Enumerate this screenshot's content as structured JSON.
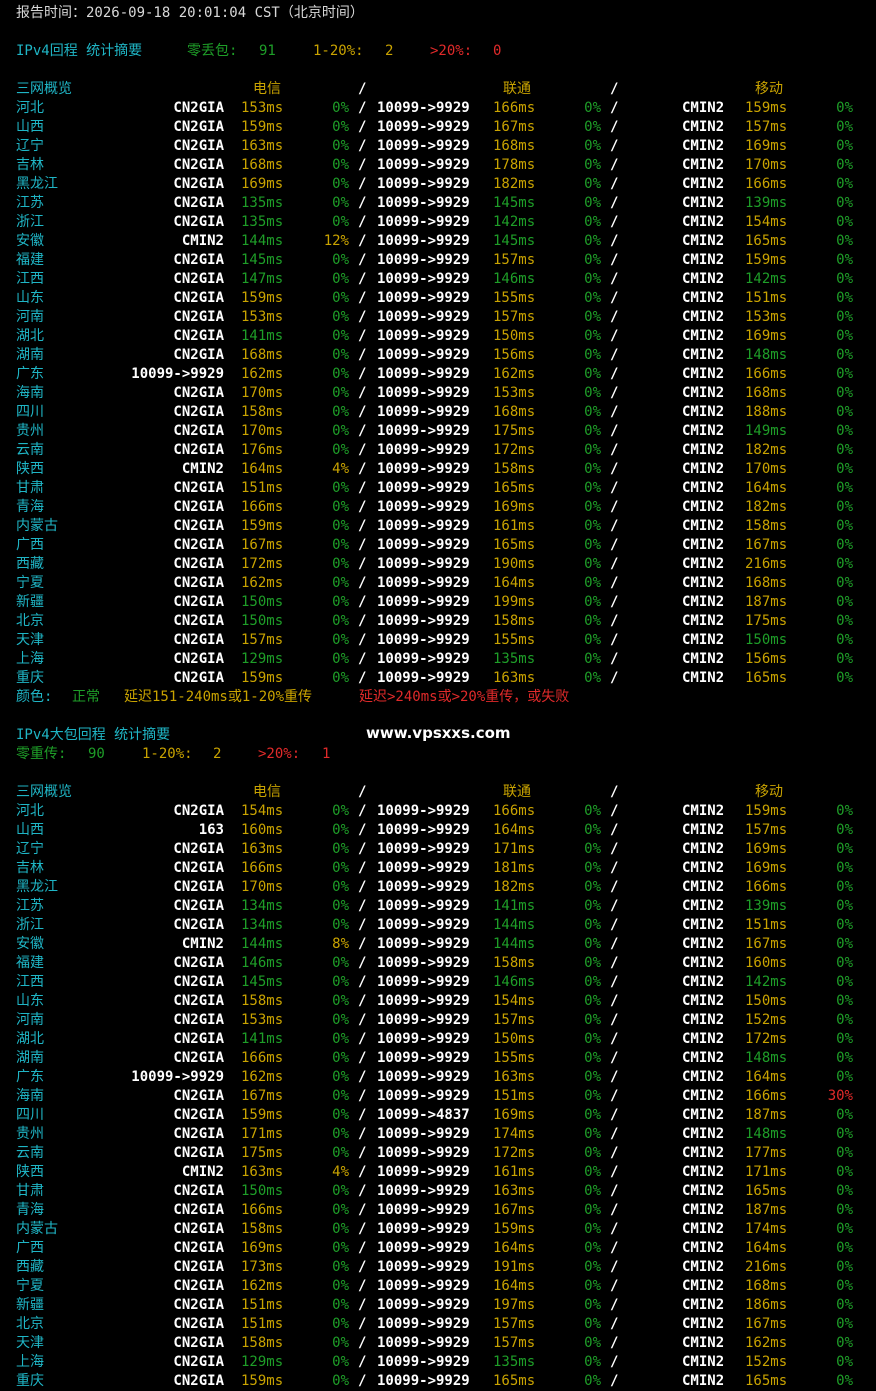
{
  "report_time": "报告时间：2026-09-18 20:01:04 CST（北京时间）",
  "colors": {
    "background": "#000000",
    "normal": "#1e9e28",
    "warn": "#c9a300",
    "bad": "#e02a2a",
    "label": "#1fb5c5",
    "route": "#ffffff"
  },
  "watermark": "www.vpsxxs.com",
  "legend": {
    "label": "颜色:",
    "normal": "正常",
    "warn": "延迟151-240ms或1-20%重传",
    "bad": "延迟>240ms或>20%重传，或失败"
  },
  "header": {
    "region": "三网概览",
    "telecom": "电信",
    "sep": "/",
    "unicom": "联通",
    "mobile": "移动"
  },
  "sections": [
    {
      "title": "IPv4回程 统计摘要",
      "summary": [
        {
          "label": "零丢包:",
          "value": "91",
          "level": "g"
        },
        {
          "label": "1-20%:",
          "value": "2",
          "level": "y"
        },
        {
          "label": ">20%:",
          "value": "0",
          "level": "r"
        }
      ],
      "rows": [
        [
          "河北",
          "CN2GIA",
          "153ms",
          "y",
          "0%",
          "g",
          "10099->9929",
          "166ms",
          "y",
          "0%",
          "g",
          "CMIN2",
          "159ms",
          "y",
          "0%",
          "g"
        ],
        [
          "山西",
          "CN2GIA",
          "159ms",
          "y",
          "0%",
          "g",
          "10099->9929",
          "167ms",
          "y",
          "0%",
          "g",
          "CMIN2",
          "157ms",
          "y",
          "0%",
          "g"
        ],
        [
          "辽宁",
          "CN2GIA",
          "163ms",
          "y",
          "0%",
          "g",
          "10099->9929",
          "168ms",
          "y",
          "0%",
          "g",
          "CMIN2",
          "169ms",
          "y",
          "0%",
          "g"
        ],
        [
          "吉林",
          "CN2GIA",
          "168ms",
          "y",
          "0%",
          "g",
          "10099->9929",
          "178ms",
          "y",
          "0%",
          "g",
          "CMIN2",
          "170ms",
          "y",
          "0%",
          "g"
        ],
        [
          "黑龙江",
          "CN2GIA",
          "169ms",
          "y",
          "0%",
          "g",
          "10099->9929",
          "182ms",
          "y",
          "0%",
          "g",
          "CMIN2",
          "166ms",
          "y",
          "0%",
          "g"
        ],
        [
          "江苏",
          "CN2GIA",
          "135ms",
          "g",
          "0%",
          "g",
          "10099->9929",
          "145ms",
          "g",
          "0%",
          "g",
          "CMIN2",
          "139ms",
          "g",
          "0%",
          "g"
        ],
        [
          "浙江",
          "CN2GIA",
          "135ms",
          "g",
          "0%",
          "g",
          "10099->9929",
          "142ms",
          "g",
          "0%",
          "g",
          "CMIN2",
          "154ms",
          "y",
          "0%",
          "g"
        ],
        [
          "安徽",
          "CMIN2",
          "144ms",
          "g",
          "12%",
          "y",
          "10099->9929",
          "145ms",
          "g",
          "0%",
          "g",
          "CMIN2",
          "165ms",
          "y",
          "0%",
          "g"
        ],
        [
          "福建",
          "CN2GIA",
          "145ms",
          "g",
          "0%",
          "g",
          "10099->9929",
          "157ms",
          "y",
          "0%",
          "g",
          "CMIN2",
          "159ms",
          "y",
          "0%",
          "g"
        ],
        [
          "江西",
          "CN2GIA",
          "147ms",
          "g",
          "0%",
          "g",
          "10099->9929",
          "146ms",
          "g",
          "0%",
          "g",
          "CMIN2",
          "142ms",
          "g",
          "0%",
          "g"
        ],
        [
          "山东",
          "CN2GIA",
          "159ms",
          "y",
          "0%",
          "g",
          "10099->9929",
          "155ms",
          "y",
          "0%",
          "g",
          "CMIN2",
          "151ms",
          "y",
          "0%",
          "g"
        ],
        [
          "河南",
          "CN2GIA",
          "153ms",
          "y",
          "0%",
          "g",
          "10099->9929",
          "157ms",
          "y",
          "0%",
          "g",
          "CMIN2",
          "153ms",
          "y",
          "0%",
          "g"
        ],
        [
          "湖北",
          "CN2GIA",
          "141ms",
          "g",
          "0%",
          "g",
          "10099->9929",
          "150ms",
          "y",
          "0%",
          "g",
          "CMIN2",
          "169ms",
          "y",
          "0%",
          "g"
        ],
        [
          "湖南",
          "CN2GIA",
          "168ms",
          "y",
          "0%",
          "g",
          "10099->9929",
          "156ms",
          "y",
          "0%",
          "g",
          "CMIN2",
          "148ms",
          "g",
          "0%",
          "g"
        ],
        [
          "广东",
          "10099->9929",
          "162ms",
          "y",
          "0%",
          "g",
          "10099->9929",
          "162ms",
          "y",
          "0%",
          "g",
          "CMIN2",
          "166ms",
          "y",
          "0%",
          "g"
        ],
        [
          "海南",
          "CN2GIA",
          "170ms",
          "y",
          "0%",
          "g",
          "10099->9929",
          "153ms",
          "y",
          "0%",
          "g",
          "CMIN2",
          "168ms",
          "y",
          "0%",
          "g"
        ],
        [
          "四川",
          "CN2GIA",
          "158ms",
          "y",
          "0%",
          "g",
          "10099->9929",
          "168ms",
          "y",
          "0%",
          "g",
          "CMIN2",
          "188ms",
          "y",
          "0%",
          "g"
        ],
        [
          "贵州",
          "CN2GIA",
          "170ms",
          "y",
          "0%",
          "g",
          "10099->9929",
          "175ms",
          "y",
          "0%",
          "g",
          "CMIN2",
          "149ms",
          "g",
          "0%",
          "g"
        ],
        [
          "云南",
          "CN2GIA",
          "176ms",
          "y",
          "0%",
          "g",
          "10099->9929",
          "172ms",
          "y",
          "0%",
          "g",
          "CMIN2",
          "182ms",
          "y",
          "0%",
          "g"
        ],
        [
          "陕西",
          "CMIN2",
          "164ms",
          "y",
          "4%",
          "y",
          "10099->9929",
          "158ms",
          "y",
          "0%",
          "g",
          "CMIN2",
          "170ms",
          "y",
          "0%",
          "g"
        ],
        [
          "甘肃",
          "CN2GIA",
          "151ms",
          "y",
          "0%",
          "g",
          "10099->9929",
          "165ms",
          "y",
          "0%",
          "g",
          "CMIN2",
          "164ms",
          "y",
          "0%",
          "g"
        ],
        [
          "青海",
          "CN2GIA",
          "166ms",
          "y",
          "0%",
          "g",
          "10099->9929",
          "169ms",
          "y",
          "0%",
          "g",
          "CMIN2",
          "182ms",
          "y",
          "0%",
          "g"
        ],
        [
          "内蒙古",
          "CN2GIA",
          "159ms",
          "y",
          "0%",
          "g",
          "10099->9929",
          "161ms",
          "y",
          "0%",
          "g",
          "CMIN2",
          "158ms",
          "y",
          "0%",
          "g"
        ],
        [
          "广西",
          "CN2GIA",
          "167ms",
          "y",
          "0%",
          "g",
          "10099->9929",
          "165ms",
          "y",
          "0%",
          "g",
          "CMIN2",
          "167ms",
          "y",
          "0%",
          "g"
        ],
        [
          "西藏",
          "CN2GIA",
          "172ms",
          "y",
          "0%",
          "g",
          "10099->9929",
          "190ms",
          "y",
          "0%",
          "g",
          "CMIN2",
          "216ms",
          "y",
          "0%",
          "g"
        ],
        [
          "宁夏",
          "CN2GIA",
          "162ms",
          "y",
          "0%",
          "g",
          "10099->9929",
          "164ms",
          "y",
          "0%",
          "g",
          "CMIN2",
          "168ms",
          "y",
          "0%",
          "g"
        ],
        [
          "新疆",
          "CN2GIA",
          "150ms",
          "g",
          "0%",
          "g",
          "10099->9929",
          "199ms",
          "y",
          "0%",
          "g",
          "CMIN2",
          "187ms",
          "y",
          "0%",
          "g"
        ],
        [
          "北京",
          "CN2GIA",
          "150ms",
          "g",
          "0%",
          "g",
          "10099->9929",
          "158ms",
          "y",
          "0%",
          "g",
          "CMIN2",
          "175ms",
          "y",
          "0%",
          "g"
        ],
        [
          "天津",
          "CN2GIA",
          "157ms",
          "y",
          "0%",
          "g",
          "10099->9929",
          "155ms",
          "y",
          "0%",
          "g",
          "CMIN2",
          "150ms",
          "g",
          "0%",
          "g"
        ],
        [
          "上海",
          "CN2GIA",
          "129ms",
          "g",
          "0%",
          "g",
          "10099->9929",
          "135ms",
          "g",
          "0%",
          "g",
          "CMIN2",
          "156ms",
          "y",
          "0%",
          "g"
        ],
        [
          "重庆",
          "CN2GIA",
          "159ms",
          "y",
          "0%",
          "g",
          "10099->9929",
          "163ms",
          "y",
          "0%",
          "g",
          "CMIN2",
          "165ms",
          "y",
          "0%",
          "g"
        ]
      ]
    },
    {
      "title": "IPv4大包回程 统计摘要",
      "summary": [
        {
          "label": "零重传:",
          "value": "90",
          "level": "g"
        },
        {
          "label": "1-20%:",
          "value": "2",
          "level": "y"
        },
        {
          "label": ">20%:",
          "value": "1",
          "level": "r"
        }
      ],
      "rows": [
        [
          "河北",
          "CN2GIA",
          "154ms",
          "y",
          "0%",
          "g",
          "10099->9929",
          "166ms",
          "y",
          "0%",
          "g",
          "CMIN2",
          "159ms",
          "y",
          "0%",
          "g"
        ],
        [
          "山西",
          "163",
          "160ms",
          "y",
          "0%",
          "g",
          "10099->9929",
          "164ms",
          "y",
          "0%",
          "g",
          "CMIN2",
          "157ms",
          "y",
          "0%",
          "g"
        ],
        [
          "辽宁",
          "CN2GIA",
          "163ms",
          "y",
          "0%",
          "g",
          "10099->9929",
          "171ms",
          "y",
          "0%",
          "g",
          "CMIN2",
          "169ms",
          "y",
          "0%",
          "g"
        ],
        [
          "吉林",
          "CN2GIA",
          "166ms",
          "y",
          "0%",
          "g",
          "10099->9929",
          "181ms",
          "y",
          "0%",
          "g",
          "CMIN2",
          "169ms",
          "y",
          "0%",
          "g"
        ],
        [
          "黑龙江",
          "CN2GIA",
          "170ms",
          "y",
          "0%",
          "g",
          "10099->9929",
          "182ms",
          "y",
          "0%",
          "g",
          "CMIN2",
          "166ms",
          "y",
          "0%",
          "g"
        ],
        [
          "江苏",
          "CN2GIA",
          "134ms",
          "g",
          "0%",
          "g",
          "10099->9929",
          "141ms",
          "g",
          "0%",
          "g",
          "CMIN2",
          "139ms",
          "g",
          "0%",
          "g"
        ],
        [
          "浙江",
          "CN2GIA",
          "134ms",
          "g",
          "0%",
          "g",
          "10099->9929",
          "144ms",
          "g",
          "0%",
          "g",
          "CMIN2",
          "151ms",
          "y",
          "0%",
          "g"
        ],
        [
          "安徽",
          "CMIN2",
          "144ms",
          "g",
          "8%",
          "y",
          "10099->9929",
          "144ms",
          "g",
          "0%",
          "g",
          "CMIN2",
          "167ms",
          "y",
          "0%",
          "g"
        ],
        [
          "福建",
          "CN2GIA",
          "146ms",
          "g",
          "0%",
          "g",
          "10099->9929",
          "158ms",
          "y",
          "0%",
          "g",
          "CMIN2",
          "160ms",
          "y",
          "0%",
          "g"
        ],
        [
          "江西",
          "CN2GIA",
          "145ms",
          "g",
          "0%",
          "g",
          "10099->9929",
          "146ms",
          "g",
          "0%",
          "g",
          "CMIN2",
          "142ms",
          "g",
          "0%",
          "g"
        ],
        [
          "山东",
          "CN2GIA",
          "158ms",
          "y",
          "0%",
          "g",
          "10099->9929",
          "154ms",
          "y",
          "0%",
          "g",
          "CMIN2",
          "150ms",
          "y",
          "0%",
          "g"
        ],
        [
          "河南",
          "CN2GIA",
          "153ms",
          "y",
          "0%",
          "g",
          "10099->9929",
          "157ms",
          "y",
          "0%",
          "g",
          "CMIN2",
          "152ms",
          "y",
          "0%",
          "g"
        ],
        [
          "湖北",
          "CN2GIA",
          "141ms",
          "g",
          "0%",
          "g",
          "10099->9929",
          "150ms",
          "y",
          "0%",
          "g",
          "CMIN2",
          "172ms",
          "y",
          "0%",
          "g"
        ],
        [
          "湖南",
          "CN2GIA",
          "166ms",
          "y",
          "0%",
          "g",
          "10099->9929",
          "155ms",
          "y",
          "0%",
          "g",
          "CMIN2",
          "148ms",
          "g",
          "0%",
          "g"
        ],
        [
          "广东",
          "10099->9929",
          "162ms",
          "y",
          "0%",
          "g",
          "10099->9929",
          "163ms",
          "y",
          "0%",
          "g",
          "CMIN2",
          "164ms",
          "y",
          "0%",
          "g"
        ],
        [
          "海南",
          "CN2GIA",
          "167ms",
          "y",
          "0%",
          "g",
          "10099->9929",
          "151ms",
          "y",
          "0%",
          "g",
          "CMIN2",
          "166ms",
          "y",
          "30%",
          "r"
        ],
        [
          "四川",
          "CN2GIA",
          "159ms",
          "y",
          "0%",
          "g",
          "10099->4837",
          "169ms",
          "y",
          "0%",
          "g",
          "CMIN2",
          "187ms",
          "y",
          "0%",
          "g"
        ],
        [
          "贵州",
          "CN2GIA",
          "171ms",
          "y",
          "0%",
          "g",
          "10099->9929",
          "174ms",
          "y",
          "0%",
          "g",
          "CMIN2",
          "148ms",
          "g",
          "0%",
          "g"
        ],
        [
          "云南",
          "CN2GIA",
          "175ms",
          "y",
          "0%",
          "g",
          "10099->9929",
          "172ms",
          "y",
          "0%",
          "g",
          "CMIN2",
          "177ms",
          "y",
          "0%",
          "g"
        ],
        [
          "陕西",
          "CMIN2",
          "163ms",
          "y",
          "4%",
          "y",
          "10099->9929",
          "161ms",
          "y",
          "0%",
          "g",
          "CMIN2",
          "171ms",
          "y",
          "0%",
          "g"
        ],
        [
          "甘肃",
          "CN2GIA",
          "150ms",
          "g",
          "0%",
          "g",
          "10099->9929",
          "163ms",
          "y",
          "0%",
          "g",
          "CMIN2",
          "165ms",
          "y",
          "0%",
          "g"
        ],
        [
          "青海",
          "CN2GIA",
          "166ms",
          "y",
          "0%",
          "g",
          "10099->9929",
          "167ms",
          "y",
          "0%",
          "g",
          "CMIN2",
          "187ms",
          "y",
          "0%",
          "g"
        ],
        [
          "内蒙古",
          "CN2GIA",
          "158ms",
          "y",
          "0%",
          "g",
          "10099->9929",
          "159ms",
          "y",
          "0%",
          "g",
          "CMIN2",
          "174ms",
          "y",
          "0%",
          "g"
        ],
        [
          "广西",
          "CN2GIA",
          "169ms",
          "y",
          "0%",
          "g",
          "10099->9929",
          "164ms",
          "y",
          "0%",
          "g",
          "CMIN2",
          "164ms",
          "y",
          "0%",
          "g"
        ],
        [
          "西藏",
          "CN2GIA",
          "173ms",
          "y",
          "0%",
          "g",
          "10099->9929",
          "191ms",
          "y",
          "0%",
          "g",
          "CMIN2",
          "216ms",
          "y",
          "0%",
          "g"
        ],
        [
          "宁夏",
          "CN2GIA",
          "162ms",
          "y",
          "0%",
          "g",
          "10099->9929",
          "164ms",
          "y",
          "0%",
          "g",
          "CMIN2",
          "168ms",
          "y",
          "0%",
          "g"
        ],
        [
          "新疆",
          "CN2GIA",
          "151ms",
          "y",
          "0%",
          "g",
          "10099->9929",
          "197ms",
          "y",
          "0%",
          "g",
          "CMIN2",
          "186ms",
          "y",
          "0%",
          "g"
        ],
        [
          "北京",
          "CN2GIA",
          "151ms",
          "y",
          "0%",
          "g",
          "10099->9929",
          "157ms",
          "y",
          "0%",
          "g",
          "CMIN2",
          "167ms",
          "y",
          "0%",
          "g"
        ],
        [
          "天津",
          "CN2GIA",
          "158ms",
          "y",
          "0%",
          "g",
          "10099->9929",
          "157ms",
          "y",
          "0%",
          "g",
          "CMIN2",
          "162ms",
          "y",
          "0%",
          "g"
        ],
        [
          "上海",
          "CN2GIA",
          "129ms",
          "g",
          "0%",
          "g",
          "10099->9929",
          "135ms",
          "g",
          "0%",
          "g",
          "CMIN2",
          "152ms",
          "y",
          "0%",
          "g"
        ],
        [
          "重庆",
          "CN2GIA",
          "159ms",
          "y",
          "0%",
          "g",
          "10099->9929",
          "165ms",
          "y",
          "0%",
          "g",
          "CMIN2",
          "165ms",
          "y",
          "0%",
          "g"
        ]
      ]
    }
  ]
}
